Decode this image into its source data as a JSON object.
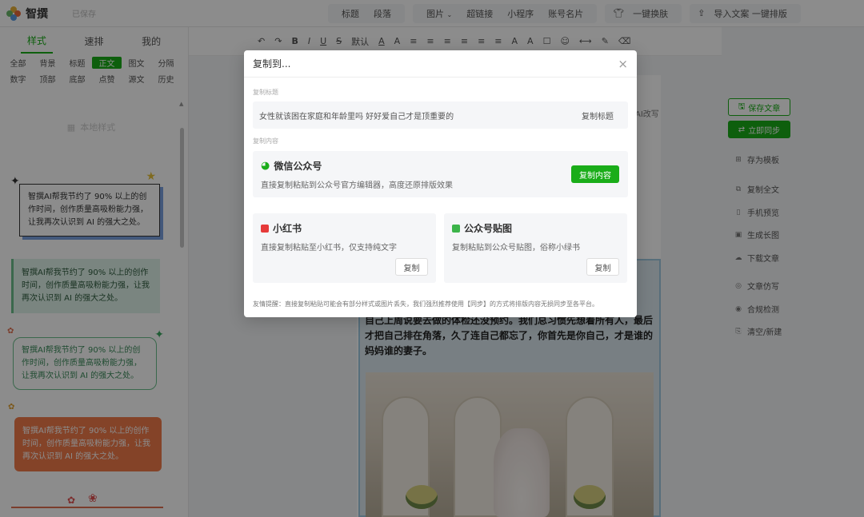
{
  "app": {
    "name": "智撰",
    "draft_status": "已保存"
  },
  "header": {
    "group1": [
      "标题",
      "段落"
    ],
    "group2": [
      "图片",
      "超链接",
      "小程序",
      "账号名片"
    ],
    "group3": [
      "一键换肤"
    ],
    "group4": [
      "导入文案 一键排版"
    ]
  },
  "left": {
    "tabs": [
      "样式",
      "速排",
      "我的"
    ],
    "categories_row1": [
      "全部",
      "背景",
      "标题",
      "正文",
      "图文",
      "分隔"
    ],
    "categories_row2": [
      "数字",
      "顶部",
      "底部",
      "点赞",
      "源文",
      "历史"
    ],
    "no_recent": "本地样式",
    "card_text": "智撰AI帮我节约了 90% 以上的创作时间，创作质量高吸粉能力强，让我再次认识到 AI 的强大之处。"
  },
  "toolbar": {
    "font_size": "默认",
    "items": [
      "↶",
      "↷",
      "B",
      "I",
      "U",
      "S",
      "默认",
      "A",
      "A",
      "≡",
      "≡",
      "≡",
      "≡",
      "≡",
      "≡",
      "A",
      "A",
      "☐",
      "☺",
      "⟷",
      "✎",
      "⌫"
    ]
  },
  "editor": {
    "ai_tag": "AI改写",
    "article_text": "自己上周说要去做的体检还没预约。我们总习惯先想着所有人，最后才把自己排在角落，久了连自己都忘了，你首先是你自己，才是谁的妈妈谁的妻子。"
  },
  "right": {
    "save": "保存文章",
    "sync": "立即同步",
    "items": [
      "存为模板",
      "复制全文",
      "手机预览",
      "生成长图",
      "下载文章",
      "文章仿写",
      "合规检测",
      "清空/新建"
    ]
  },
  "modal": {
    "title": "复制到...",
    "section_title_label": "复制标题",
    "article_title": "女性就该困在家庭和年龄里吗 好好爱自己才是顶重要的",
    "copy_title_btn": "复制标题",
    "section_content_label": "复制内容",
    "wechat": {
      "name": "微信公众号",
      "desc": "直接复制粘贴到公众号官方编辑器，高度还原排版效果",
      "btn": "复制内容"
    },
    "xhs": {
      "name": "小红书",
      "desc": "直接复制粘贴至小红书，仅支持纯文字",
      "btn": "复制"
    },
    "sticker": {
      "name": "公众号贴图",
      "desc": "复制粘贴到公众号贴图，俗称小绿书",
      "btn": "复制"
    },
    "tip": "友情提醒：直接复制粘贴可能会有部分样式或图片丢失，我们强烈推荐使用【同步】的方式将排版内容无损同步至各平台。"
  },
  "colors": {
    "accent": "#1aad19",
    "xhs": "#e63a3a"
  }
}
